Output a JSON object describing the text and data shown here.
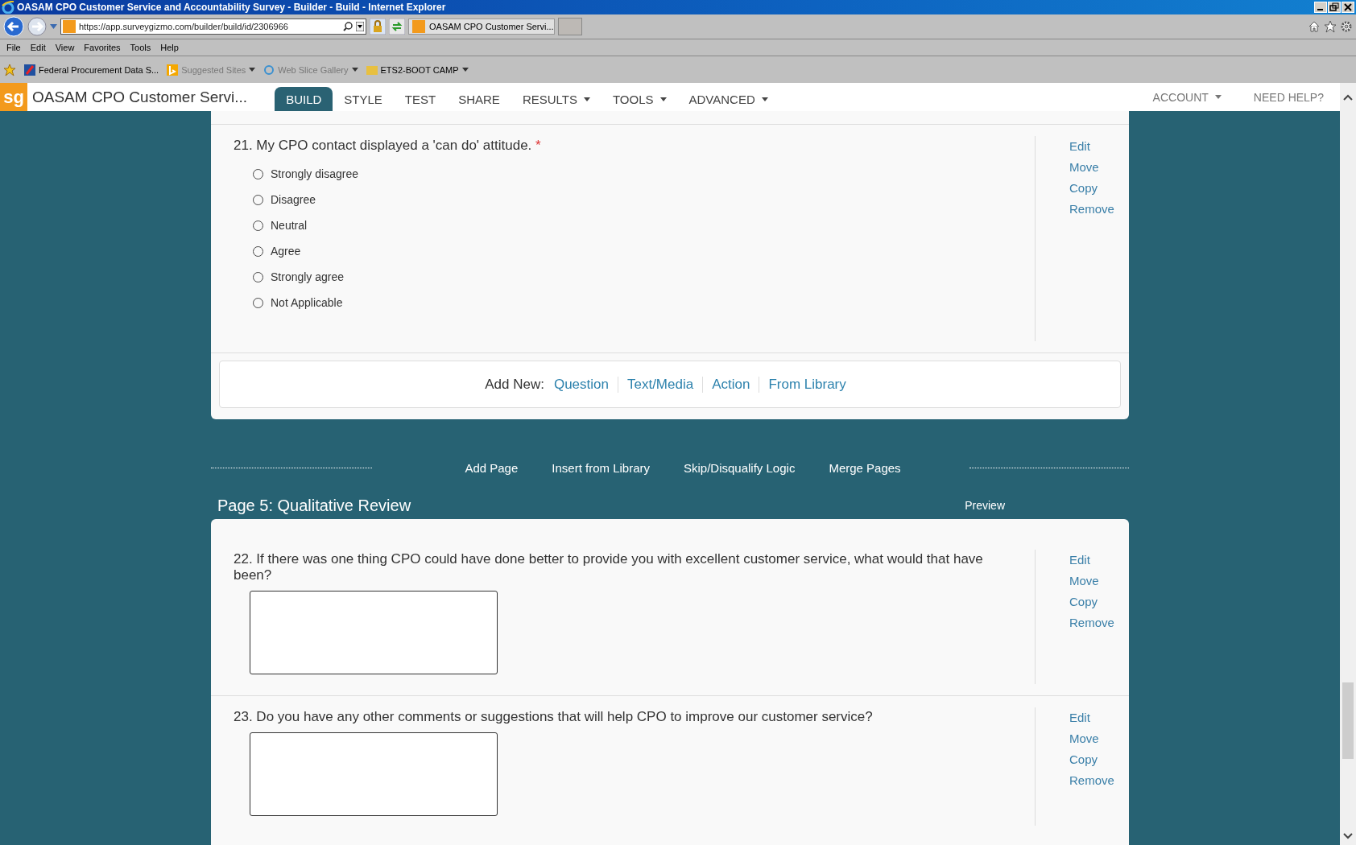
{
  "window": {
    "title": "OASAM CPO Customer Service and Accountability Survey - Builder - Build - Internet Explorer"
  },
  "browser": {
    "address": "https://app.surveygizmo.com/builder/build/id/2306966",
    "tab": "OASAM CPO Customer Servi...",
    "menu": [
      "File",
      "Edit",
      "View",
      "Favorites",
      "Tools",
      "Help"
    ],
    "favorites": [
      {
        "label": "Federal Procurement Data S...",
        "dropdown": false,
        "dimmed": false
      },
      {
        "label": "Suggested Sites",
        "dropdown": true,
        "dimmed": true
      },
      {
        "label": "Web Slice Gallery",
        "dropdown": true,
        "dimmed": true
      },
      {
        "label": "ETS2-BOOT CAMP",
        "dropdown": true,
        "dimmed": false
      }
    ]
  },
  "app": {
    "logo": "sg",
    "title": "OASAM CPO Customer Servi...",
    "tabs": [
      {
        "label": "BUILD",
        "selected": true,
        "dropdown": false
      },
      {
        "label": "STYLE",
        "selected": false,
        "dropdown": false
      },
      {
        "label": "TEST",
        "selected": false,
        "dropdown": false
      },
      {
        "label": "SHARE",
        "selected": false,
        "dropdown": false
      },
      {
        "label": "RESULTS",
        "selected": false,
        "dropdown": true
      },
      {
        "label": "TOOLS",
        "selected": false,
        "dropdown": true
      },
      {
        "label": "ADVANCED",
        "selected": false,
        "dropdown": true
      }
    ],
    "right": [
      {
        "label": "ACCOUNT",
        "dropdown": true
      },
      {
        "label": "NEED HELP?",
        "dropdown": false
      }
    ]
  },
  "question_21": {
    "number": "21.",
    "text": "My CPO contact displayed a 'can do' attitude.",
    "required_mark": "*",
    "kind": "radio",
    "options": [
      {
        "label": "Strongly disagree",
        "selected": false
      },
      {
        "label": "Disagree",
        "selected": false
      },
      {
        "label": "Neutral",
        "selected": false
      },
      {
        "label": "Agree",
        "selected": false
      },
      {
        "label": "Strongly agree",
        "selected": false
      },
      {
        "label": "Not Applicable",
        "selected": false
      }
    ],
    "actions": [
      "Edit",
      "Move",
      "Copy",
      "Remove"
    ]
  },
  "add_new": {
    "label": "Add New:",
    "links": [
      "Question",
      "Text/Media",
      "Action",
      "From Library"
    ]
  },
  "page_actions": [
    "Add Page",
    "Insert from Library",
    "Skip/Disqualify Logic",
    "Merge Pages"
  ],
  "page": {
    "title": "Page 5: Qualitative Review",
    "preview": "Preview",
    "questions": [
      {
        "number": "22.",
        "text": "If there was one thing CPO could have done better to provide you with excellent customer service, what would that have been?",
        "kind": "essay",
        "actions": [
          "Edit",
          "Move",
          "Copy",
          "Remove"
        ]
      },
      {
        "number": "23.",
        "text": "Do you have any other comments or suggestions that will help CPO to improve our customer service?",
        "kind": "essay",
        "actions": [
          "Edit",
          "Move",
          "Copy",
          "Remove"
        ]
      }
    ]
  }
}
